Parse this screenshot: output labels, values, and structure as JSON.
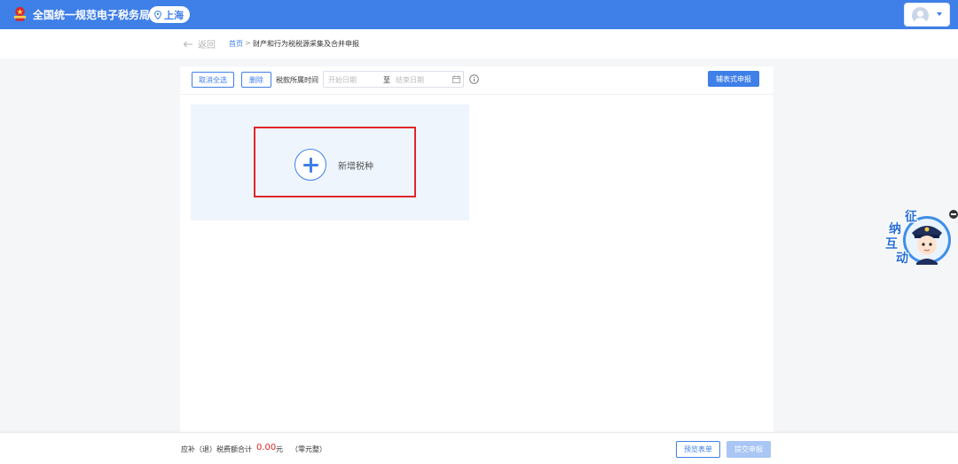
{
  "header": {
    "site_title": "全国统一规范电子税务局",
    "region": "上海"
  },
  "breadcrumb": {
    "back_label": "返回",
    "home": "首页",
    "separator": ">",
    "current": "财产和行为税税源采集及合并申报"
  },
  "toolbar": {
    "cancel_all": "取消全选",
    "delete": "删除",
    "date_label": "税款所属时间",
    "start_placeholder": "开始日期",
    "range_separator": "至",
    "end_placeholder": "结束日期",
    "guided_declare": "辅表式申报"
  },
  "add_card": {
    "label": "新增税种"
  },
  "mascot": {
    "lines": [
      "征",
      "纳",
      "互",
      "动"
    ]
  },
  "footer": {
    "total_label": "应补（退）税费额合计",
    "total_value": "0.00",
    "unit": "元",
    "amount_in_words": "（零元整）",
    "preview": "预览表单",
    "submit": "提交申报"
  },
  "colors": {
    "primary": "#3f7fe8",
    "danger": "#e0262b",
    "disabled": "#a9c6f4"
  },
  "icons": [
    "emblem-logo",
    "location-pin-icon",
    "avatar",
    "caret-down-icon",
    "arrow-left-icon",
    "calendar-icon",
    "info-icon",
    "plus-icon",
    "mascot",
    "collapse-icon"
  ]
}
